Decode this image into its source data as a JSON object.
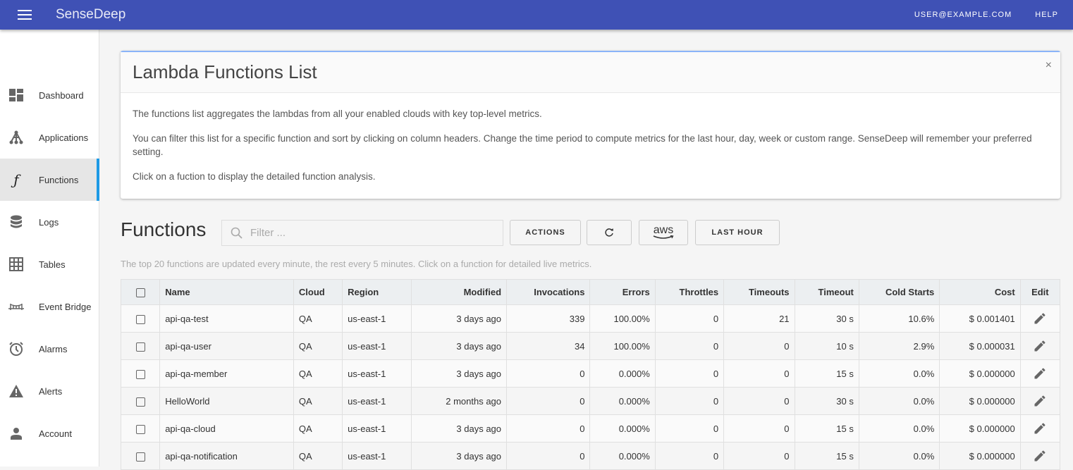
{
  "app": {
    "brand": "SenseDeep",
    "user_email": "USER@EXAMPLE.COM",
    "help": "HELP"
  },
  "sidebar": {
    "items": [
      {
        "label": "Dashboard",
        "icon": "dashboard-icon"
      },
      {
        "label": "Applications",
        "icon": "applications-icon"
      },
      {
        "label": "Functions",
        "icon": "function-icon",
        "active": true
      },
      {
        "label": "Logs",
        "icon": "database-icon"
      },
      {
        "label": "Tables",
        "icon": "grid-icon"
      },
      {
        "label": "Event Bridge",
        "icon": "bridge-icon"
      },
      {
        "label": "Alarms",
        "icon": "alarm-clock-icon"
      },
      {
        "label": "Alerts",
        "icon": "warning-icon"
      },
      {
        "label": "Account",
        "icon": "person-icon"
      }
    ]
  },
  "info": {
    "title": "Lambda Functions List",
    "close": "×",
    "paragraphs": [
      "The functions list aggregates the lambdas from all your enabled clouds with key top-level metrics.",
      "You can filter this list for a specific function and sort by clicking on column headers. Change the time period to compute metrics for the last hour, day, week or custom range. SenseDeep will remember your preferred setting.",
      "Click on a fuction to display the detailed function analysis."
    ]
  },
  "functions": {
    "title": "Functions",
    "filter_placeholder": "Filter ...",
    "filter_value": "",
    "actions_label": "ACTIONS",
    "refresh_icon": "refresh-icon",
    "cloud_label": "aws",
    "period_label": "LAST HOUR",
    "hint": "The top 20 functions are updated every minute, the rest every 5 minutes. Click on a function for detailed live metrics."
  },
  "table": {
    "columns": [
      "Name",
      "Cloud",
      "Region",
      "Modified",
      "Invocations",
      "Errors",
      "Throttles",
      "Timeouts",
      "Timeout",
      "Cold Starts",
      "Cost",
      "Edit"
    ],
    "rows": [
      {
        "name": "api-qa-test",
        "cloud": "QA",
        "region": "us-east-1",
        "modified": "3 days ago",
        "invocations": "339",
        "errors": "100.00%",
        "throttles": "0",
        "timeouts": "21",
        "timeout": "30 s",
        "cold_starts": "10.6%",
        "cost": "$ 0.001401"
      },
      {
        "name": "api-qa-user",
        "cloud": "QA",
        "region": "us-east-1",
        "modified": "3 days ago",
        "invocations": "34",
        "errors": "100.00%",
        "throttles": "0",
        "timeouts": "0",
        "timeout": "10 s",
        "cold_starts": "2.9%",
        "cost": "$ 0.000031"
      },
      {
        "name": "api-qa-member",
        "cloud": "QA",
        "region": "us-east-1",
        "modified": "3 days ago",
        "invocations": "0",
        "errors": "0.000%",
        "throttles": "0",
        "timeouts": "0",
        "timeout": "15 s",
        "cold_starts": "0.0%",
        "cost": "$ 0.000000"
      },
      {
        "name": "HelloWorld",
        "cloud": "QA",
        "region": "us-east-1",
        "modified": "2 months ago",
        "invocations": "0",
        "errors": "0.000%",
        "throttles": "0",
        "timeouts": "0",
        "timeout": "30 s",
        "cold_starts": "0.0%",
        "cost": "$ 0.000000"
      },
      {
        "name": "api-qa-cloud",
        "cloud": "QA",
        "region": "us-east-1",
        "modified": "3 days ago",
        "invocations": "0",
        "errors": "0.000%",
        "throttles": "0",
        "timeouts": "0",
        "timeout": "15 s",
        "cold_starts": "0.0%",
        "cost": "$ 0.000000"
      },
      {
        "name": "api-qa-notification",
        "cloud": "QA",
        "region": "us-east-1",
        "modified": "3 days ago",
        "invocations": "0",
        "errors": "0.000%",
        "throttles": "0",
        "timeouts": "0",
        "timeout": "15 s",
        "cold_starts": "0.0%",
        "cost": "$ 0.000000"
      }
    ]
  }
}
